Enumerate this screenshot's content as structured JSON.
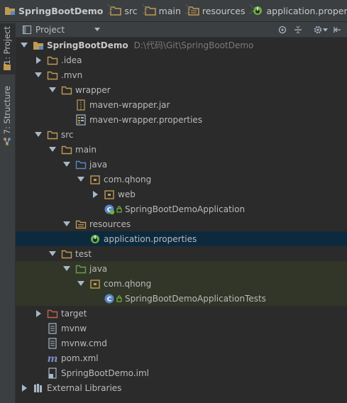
{
  "breadcrumbs": [
    {
      "label": "SpringBootDemo",
      "icon": "module-folder-icon"
    },
    {
      "label": "src",
      "icon": "folder-icon"
    },
    {
      "label": "main",
      "icon": "folder-icon"
    },
    {
      "label": "resources",
      "icon": "resources-folder-icon"
    },
    {
      "label": "application.properties",
      "icon": "spring-properties-icon"
    }
  ],
  "side_tabs": {
    "project": "1: Project",
    "structure": "7: Structure"
  },
  "panel": {
    "title": "Project"
  },
  "tree": [
    {
      "label": "SpringBootDemo",
      "path": "D:\\代码\\Git\\SpringBootDemo",
      "icon": "module-folder-icon"
    },
    {
      "label": ".idea",
      "icon": "folder-icon"
    },
    {
      "label": ".mvn",
      "icon": "folder-icon"
    },
    {
      "label": "wrapper",
      "icon": "folder-icon"
    },
    {
      "label": "maven-wrapper.jar",
      "icon": "jar-icon"
    },
    {
      "label": "maven-wrapper.properties",
      "icon": "properties-file-icon"
    },
    {
      "label": "src",
      "icon": "folder-icon"
    },
    {
      "label": "main",
      "icon": "folder-icon"
    },
    {
      "label": "java",
      "icon": "source-folder-icon"
    },
    {
      "label": "com.qhong",
      "icon": "package-icon"
    },
    {
      "label": "web",
      "icon": "package-icon"
    },
    {
      "label": "SpringBootDemoApplication",
      "icon": "spring-boot-class-icon"
    },
    {
      "label": "resources",
      "icon": "resources-folder-icon"
    },
    {
      "label": "application.properties",
      "icon": "spring-properties-icon"
    },
    {
      "label": "test",
      "icon": "folder-icon"
    },
    {
      "label": "java",
      "icon": "test-source-folder-icon"
    },
    {
      "label": "com.qhong",
      "icon": "package-icon"
    },
    {
      "label": "SpringBootDemoApplicationTests",
      "icon": "test-class-icon"
    },
    {
      "label": "target",
      "icon": "excluded-folder-icon"
    },
    {
      "label": "mvnw",
      "icon": "text-file-icon"
    },
    {
      "label": "mvnw.cmd",
      "icon": "text-file-icon"
    },
    {
      "label": "pom.xml",
      "icon": "maven-icon"
    },
    {
      "label": "SpringBootDemo.iml",
      "icon": "iml-file-icon"
    },
    {
      "label": "External Libraries",
      "icon": "libraries-icon"
    }
  ],
  "colors": {
    "selection": "#0d293e",
    "test_background": "#313628",
    "folder": "#c09a52",
    "source_folder": "#5a87c6",
    "test_folder": "#6a9e52",
    "excluded_folder": "#c0654f",
    "spring_green": "#6db33f"
  }
}
